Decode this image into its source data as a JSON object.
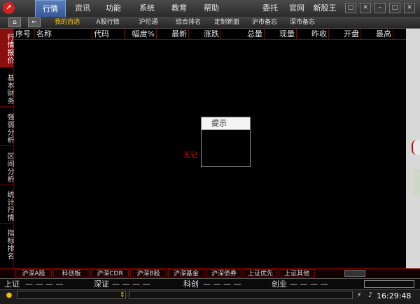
{
  "title_bar": {
    "menus": [
      "行情",
      "资讯",
      "功能",
      "系统",
      "教育",
      "帮助"
    ],
    "right_menus": [
      "委托",
      "官网",
      "新股王"
    ]
  },
  "toolbar": {
    "items": [
      "我的自选",
      "A股行情",
      "沪伦通",
      "综合排名",
      "定制新面",
      "沪市备忘",
      "深市备忘"
    ]
  },
  "sidebar": {
    "tabs": [
      "行情报价",
      "基本财务",
      "强弱分析",
      "区间分析",
      "统计行情",
      "指标排名"
    ]
  },
  "table": {
    "columns": [
      "序号",
      "名称",
      "代码",
      "幅度%",
      "最新",
      "涨跌",
      "总量",
      "现量",
      "昨收",
      "开盘",
      "最高"
    ]
  },
  "main": {
    "empty_text": "无记"
  },
  "dialog": {
    "title": "提示"
  },
  "bottom_tabs": [
    "沪深A股",
    "科创板",
    "沪深CDR",
    "沪深B股",
    "沪深基金",
    "沪深债券",
    "上证优先",
    "上证其他"
  ],
  "index_bar": [
    {
      "label": "上证",
      "values": "— — — —"
    },
    {
      "label": "深证",
      "values": "— — — —"
    },
    {
      "label": "科创",
      "values": "— — — —"
    },
    {
      "label": "创业",
      "values": "— — — —"
    }
  ],
  "status_bar": {
    "time": "16:29:48"
  },
  "colors": {
    "accent_red": "#880000",
    "active_tab": "#8a1010",
    "highlight_yellow": "#f0c000"
  }
}
